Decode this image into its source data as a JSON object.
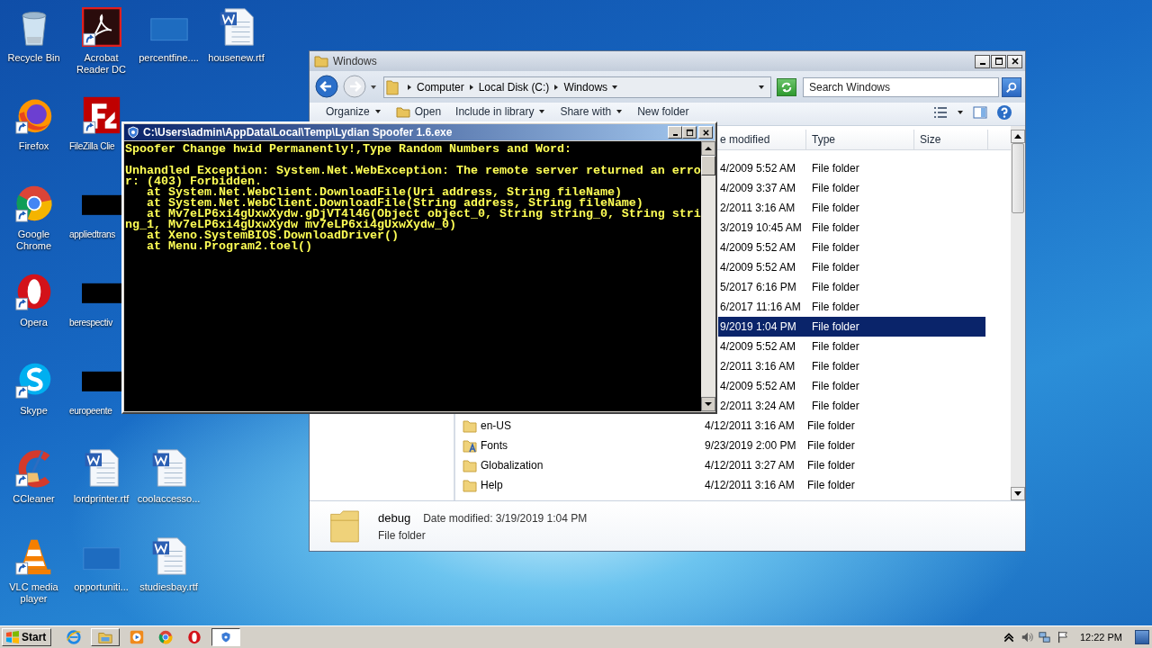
{
  "desktop_rows": [
    [
      {
        "label": "Recycle Bin",
        "kind": "recycle",
        "shortcut": false
      },
      {
        "label": "Acrobat Reader DC",
        "kind": "acrobat",
        "shortcut": true
      },
      {
        "label": "percentfine....",
        "kind": "blank",
        "shortcut": false
      },
      {
        "label": "housenew.rtf",
        "kind": "word",
        "shortcut": false
      }
    ],
    [
      {
        "label": "Firefox",
        "kind": "firefox",
        "shortcut": true
      },
      {
        "label": "FileZilla Clie",
        "kind": "filezilla",
        "shortcut": true,
        "cut": true
      }
    ],
    [
      {
        "label": "Google Chrome",
        "kind": "chrome",
        "shortcut": true
      },
      {
        "label": "appliedtrans",
        "kind": "redacted",
        "shortcut": false,
        "cut": true
      }
    ],
    [
      {
        "label": "Opera",
        "kind": "opera",
        "shortcut": true
      },
      {
        "label": "berespectiv",
        "kind": "redacted",
        "shortcut": false,
        "cut": true
      }
    ],
    [
      {
        "label": "Skype",
        "kind": "skype",
        "shortcut": true
      },
      {
        "label": "europeente",
        "kind": "redacted",
        "shortcut": false,
        "cut": true
      }
    ],
    [
      {
        "label": "CCleaner",
        "kind": "ccleaner",
        "shortcut": true
      },
      {
        "label": "lordprinter.rtf",
        "kind": "word",
        "shortcut": false
      },
      {
        "label": "coolaccesso...",
        "kind": "word",
        "shortcut": false
      }
    ],
    [
      {
        "label": "VLC media player",
        "kind": "vlc",
        "shortcut": true
      },
      {
        "label": "opportuniti...",
        "kind": "blank",
        "shortcut": false
      },
      {
        "label": "studiesbay.rtf",
        "kind": "word",
        "shortcut": false
      }
    ]
  ],
  "explorer": {
    "title": "Windows",
    "breadcrumb": [
      "Computer",
      "Local Disk (C:)",
      "Windows"
    ],
    "search": {
      "placeholder": "Search Windows"
    },
    "toolbar": [
      {
        "label": "Organize",
        "kind": "menu"
      },
      {
        "label": "Open",
        "kind": "open"
      },
      {
        "label": "Include in library",
        "kind": "menu"
      },
      {
        "label": "Share with",
        "kind": "menu"
      },
      {
        "label": "New folder",
        "kind": "plain"
      }
    ],
    "columns": [
      "e modified",
      "Type",
      "Size"
    ],
    "rows": [
      {
        "date": "4/2009 5:52 AM",
        "type": "File folder",
        "selected": false
      },
      {
        "date": "4/2009 3:37 AM",
        "type": "File folder",
        "selected": false
      },
      {
        "date": "2/2011 3:16 AM",
        "type": "File folder",
        "selected": false
      },
      {
        "date": "3/2019 10:45 AM",
        "type": "File folder",
        "selected": false
      },
      {
        "date": "4/2009 5:52 AM",
        "type": "File folder",
        "selected": false
      },
      {
        "date": "4/2009 5:52 AM",
        "type": "File folder",
        "selected": false
      },
      {
        "date": "5/2017 6:16 PM",
        "type": "File folder",
        "selected": false
      },
      {
        "date": "6/2017 11:16 AM",
        "type": "File folder",
        "selected": false
      },
      {
        "date": "9/2019 1:04 PM",
        "type": "File folder",
        "selected": true
      },
      {
        "date": "4/2009 5:52 AM",
        "type": "File folder",
        "selected": false
      },
      {
        "date": "2/2011 3:16 AM",
        "type": "File folder",
        "selected": false
      },
      {
        "date": "4/2009 5:52 AM",
        "type": "File folder",
        "selected": false
      },
      {
        "date": "2/2011 3:24 AM",
        "type": "File folder",
        "selected": false
      },
      {
        "name": "en-US",
        "kind": "folder",
        "date": "4/12/2011 3:16 AM",
        "type": "File folder",
        "selected": false
      },
      {
        "name": "Fonts",
        "kind": "fonts",
        "date": "9/23/2019 2:00 PM",
        "type": "File folder",
        "selected": false
      },
      {
        "name": "Globalization",
        "kind": "folder",
        "date": "4/12/2011 3:27 AM",
        "type": "File folder",
        "selected": false
      },
      {
        "name": "Help",
        "kind": "folder",
        "date": "4/12/2011 3:16 AM",
        "type": "File folder",
        "selected": false
      }
    ],
    "details": {
      "name": "debug",
      "date": "Date modified: 3/19/2019 1:04 PM",
      "type": "File folder"
    }
  },
  "console": {
    "title": "C:\\Users\\admin\\AppData\\Local\\Temp\\Lydian Spoofer 1.6.exe",
    "blocks": [
      [
        "Spoofer Change hwid Permanently!,Type Random Numbers and Word:"
      ],
      [
        "Unhandled Exception: System.Net.WebException: The remote server returned an erro",
        "r: (403) Forbidden.",
        "   at System.Net.WebClient.DownloadFile(Uri address, String fileName)",
        "   at System.Net.WebClient.DownloadFile(String address, String fileName)",
        "   at Mv7eLP6xi4gUxwXydw.gDjVT4l4G(Object object_0, String string_0, String stri",
        "ng_1, Mv7eLP6xi4gUxwXydw mv7eLP6xi4gUxwXydw_0)",
        "   at Xeno.SystemBIOS.DownloadDriver()",
        "   at Menu.Program2.toel()"
      ]
    ]
  },
  "taskbar": {
    "start": "Start",
    "clock": "12:22 PM",
    "apps": [
      {
        "kind": "ie",
        "open": false,
        "active": false
      },
      {
        "kind": "folder",
        "open": true,
        "active": false
      },
      {
        "kind": "media",
        "open": false,
        "active": false
      },
      {
        "kind": "chrome",
        "open": false,
        "active": false
      },
      {
        "kind": "opera",
        "open": false,
        "active": false
      },
      {
        "kind": "console",
        "open": true,
        "active": true
      }
    ]
  }
}
